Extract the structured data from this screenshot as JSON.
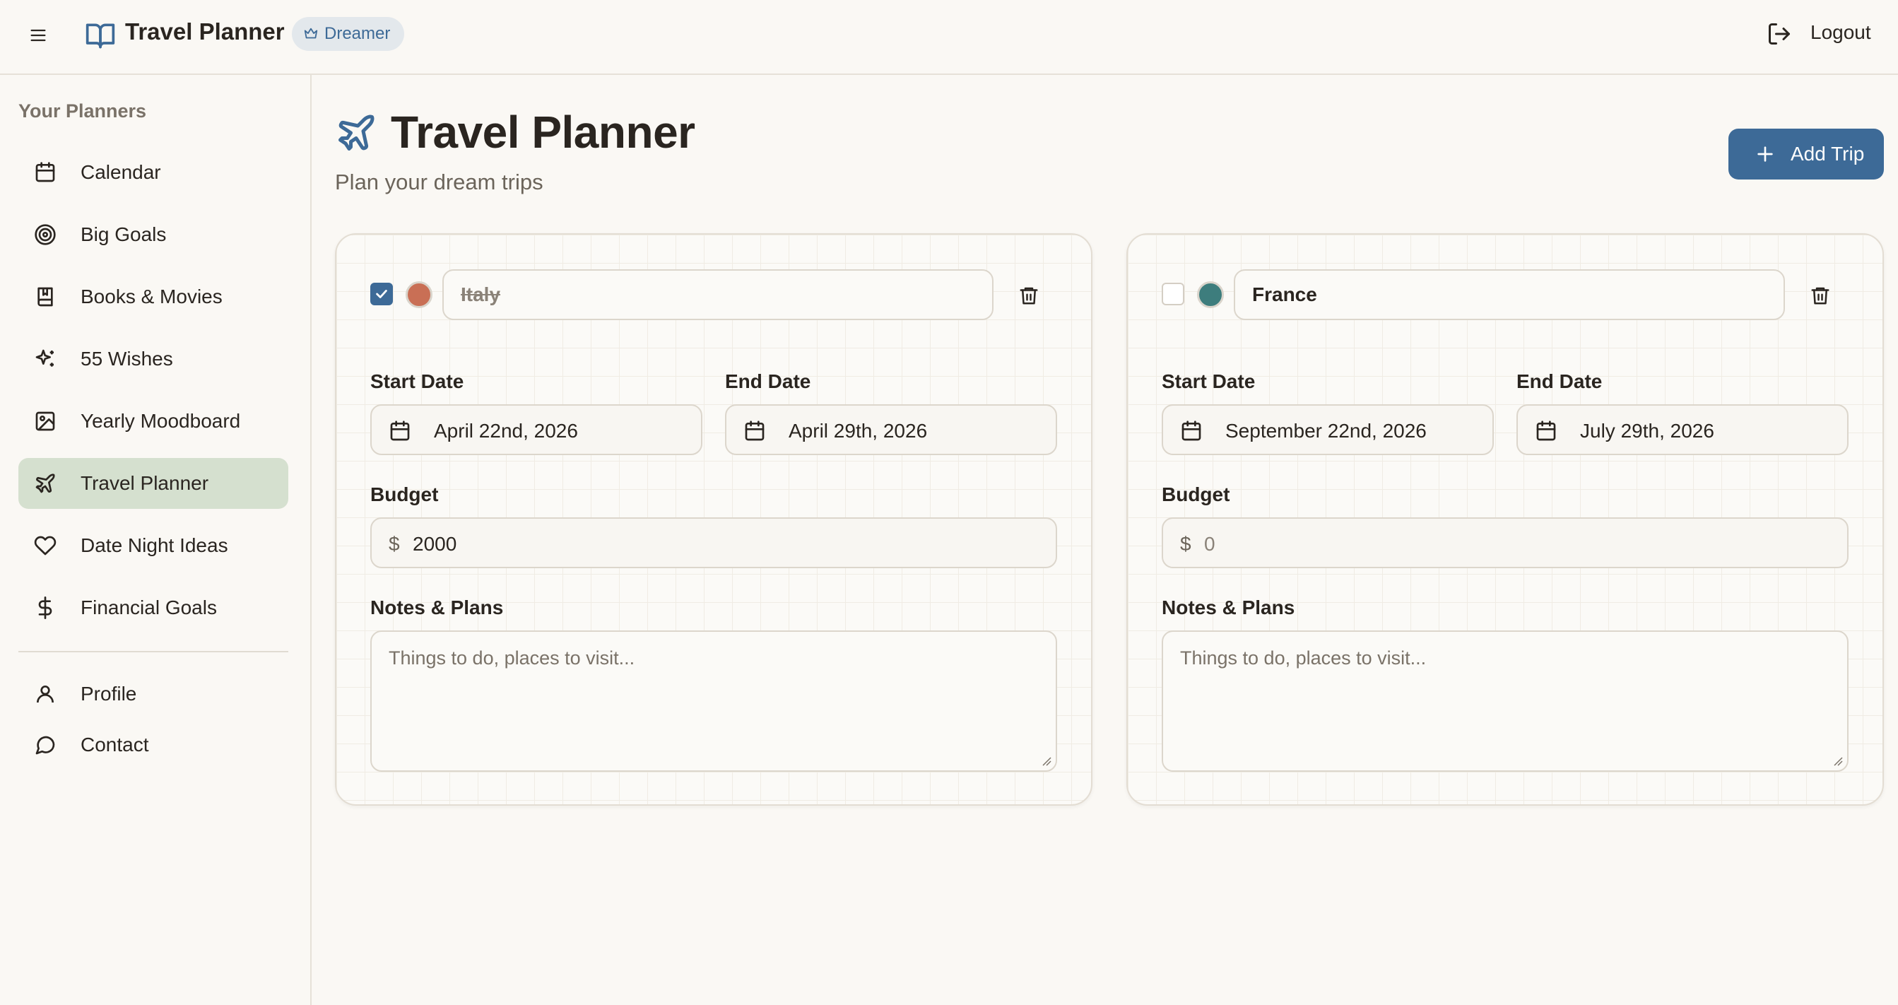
{
  "header": {
    "brand": "Travel Planner",
    "badge": "Dreamer",
    "logout": "Logout"
  },
  "sidebar": {
    "heading": "Your Planners",
    "items": [
      {
        "label": "Calendar",
        "icon": "calendar-icon"
      },
      {
        "label": "Big Goals",
        "icon": "target-icon"
      },
      {
        "label": "Books & Movies",
        "icon": "book-icon"
      },
      {
        "label": "55 Wishes",
        "icon": "sparkles-icon"
      },
      {
        "label": "Yearly Moodboard",
        "icon": "image-icon"
      },
      {
        "label": "Travel Planner",
        "icon": "plane-icon",
        "active": true
      },
      {
        "label": "Date Night Ideas",
        "icon": "heart-icon"
      },
      {
        "label": "Financial Goals",
        "icon": "dollar-icon"
      }
    ],
    "footer_items": [
      {
        "label": "Profile",
        "icon": "user-icon"
      },
      {
        "label": "Contact",
        "icon": "message-icon"
      }
    ]
  },
  "main": {
    "title": "Travel Planner",
    "subtitle": "Plan your dream trips",
    "add_button": "Add Trip"
  },
  "labels": {
    "start_date": "Start Date",
    "end_date": "End Date",
    "budget": "Budget",
    "notes": "Notes & Plans",
    "currency": "$",
    "notes_placeholder": "Things to do, places to visit..."
  },
  "trips": [
    {
      "name": "Italy",
      "completed": true,
      "color": "#c96f55",
      "start_date": "April 22nd, 2026",
      "end_date": "April 29th, 2026",
      "budget": "2000",
      "notes": ""
    },
    {
      "name": "France",
      "completed": false,
      "color": "#3d7d7d",
      "start_date": "September 22nd, 2026",
      "end_date": "July 29th, 2026",
      "budget": "0",
      "notes": ""
    }
  ],
  "colors": {
    "accent": "#3d6a97",
    "active_nav": "#d5e0cf",
    "background": "#faf8f4"
  }
}
